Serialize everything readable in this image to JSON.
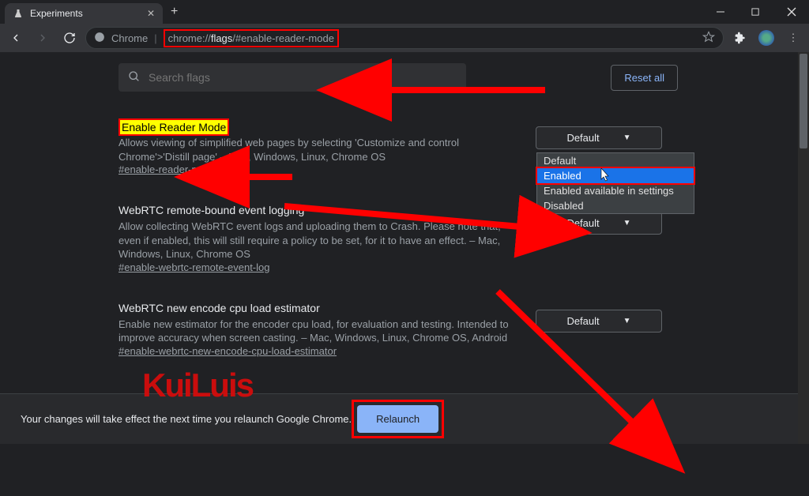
{
  "window": {
    "tab_title": "Experiments"
  },
  "toolbar": {
    "url_prefix": "Chrome",
    "url_text": "chrome://flags/#enable-reader-mode",
    "url_text_bold": "flags"
  },
  "search": {
    "placeholder": "Search flags"
  },
  "actions": {
    "reset_all": "Reset all",
    "relaunch": "Relaunch"
  },
  "dropdown": {
    "opt1": "Default",
    "opt2": "Enabled",
    "opt3": "Enabled available in settings",
    "opt4": "Disabled"
  },
  "flags": {
    "f1": {
      "title": "Enable Reader Mode",
      "desc": "Allows viewing of simplified web pages by selecting 'Customize and control Chrome'>'Distill page' – Mac, Windows, Linux, Chrome OS",
      "link": "#enable-reader-mode",
      "value": "Default"
    },
    "f2": {
      "title": "WebRTC remote-bound event logging",
      "desc": "Allow collecting WebRTC event logs and uploading them to Crash. Please note that, even if enabled, this will still require a policy to be set, for it to have an effect. – Mac, Windows, Linux, Chrome OS",
      "link": "#enable-webrtc-remote-event-log",
      "value": "Default"
    },
    "f3": {
      "title": "WebRTC new encode cpu load estimator",
      "desc": "Enable new estimator for the encoder cpu load, for evaluation and testing. Intended to improve accuracy when screen casting. – Mac, Windows, Linux, Chrome OS, Android",
      "link": "#enable-webrtc-new-encode-cpu-load-estimator",
      "value": "Default"
    }
  },
  "footer": {
    "msg": "Your changes will take effect the next time you relaunch Google Chrome."
  },
  "watermark": "KuiLuis"
}
